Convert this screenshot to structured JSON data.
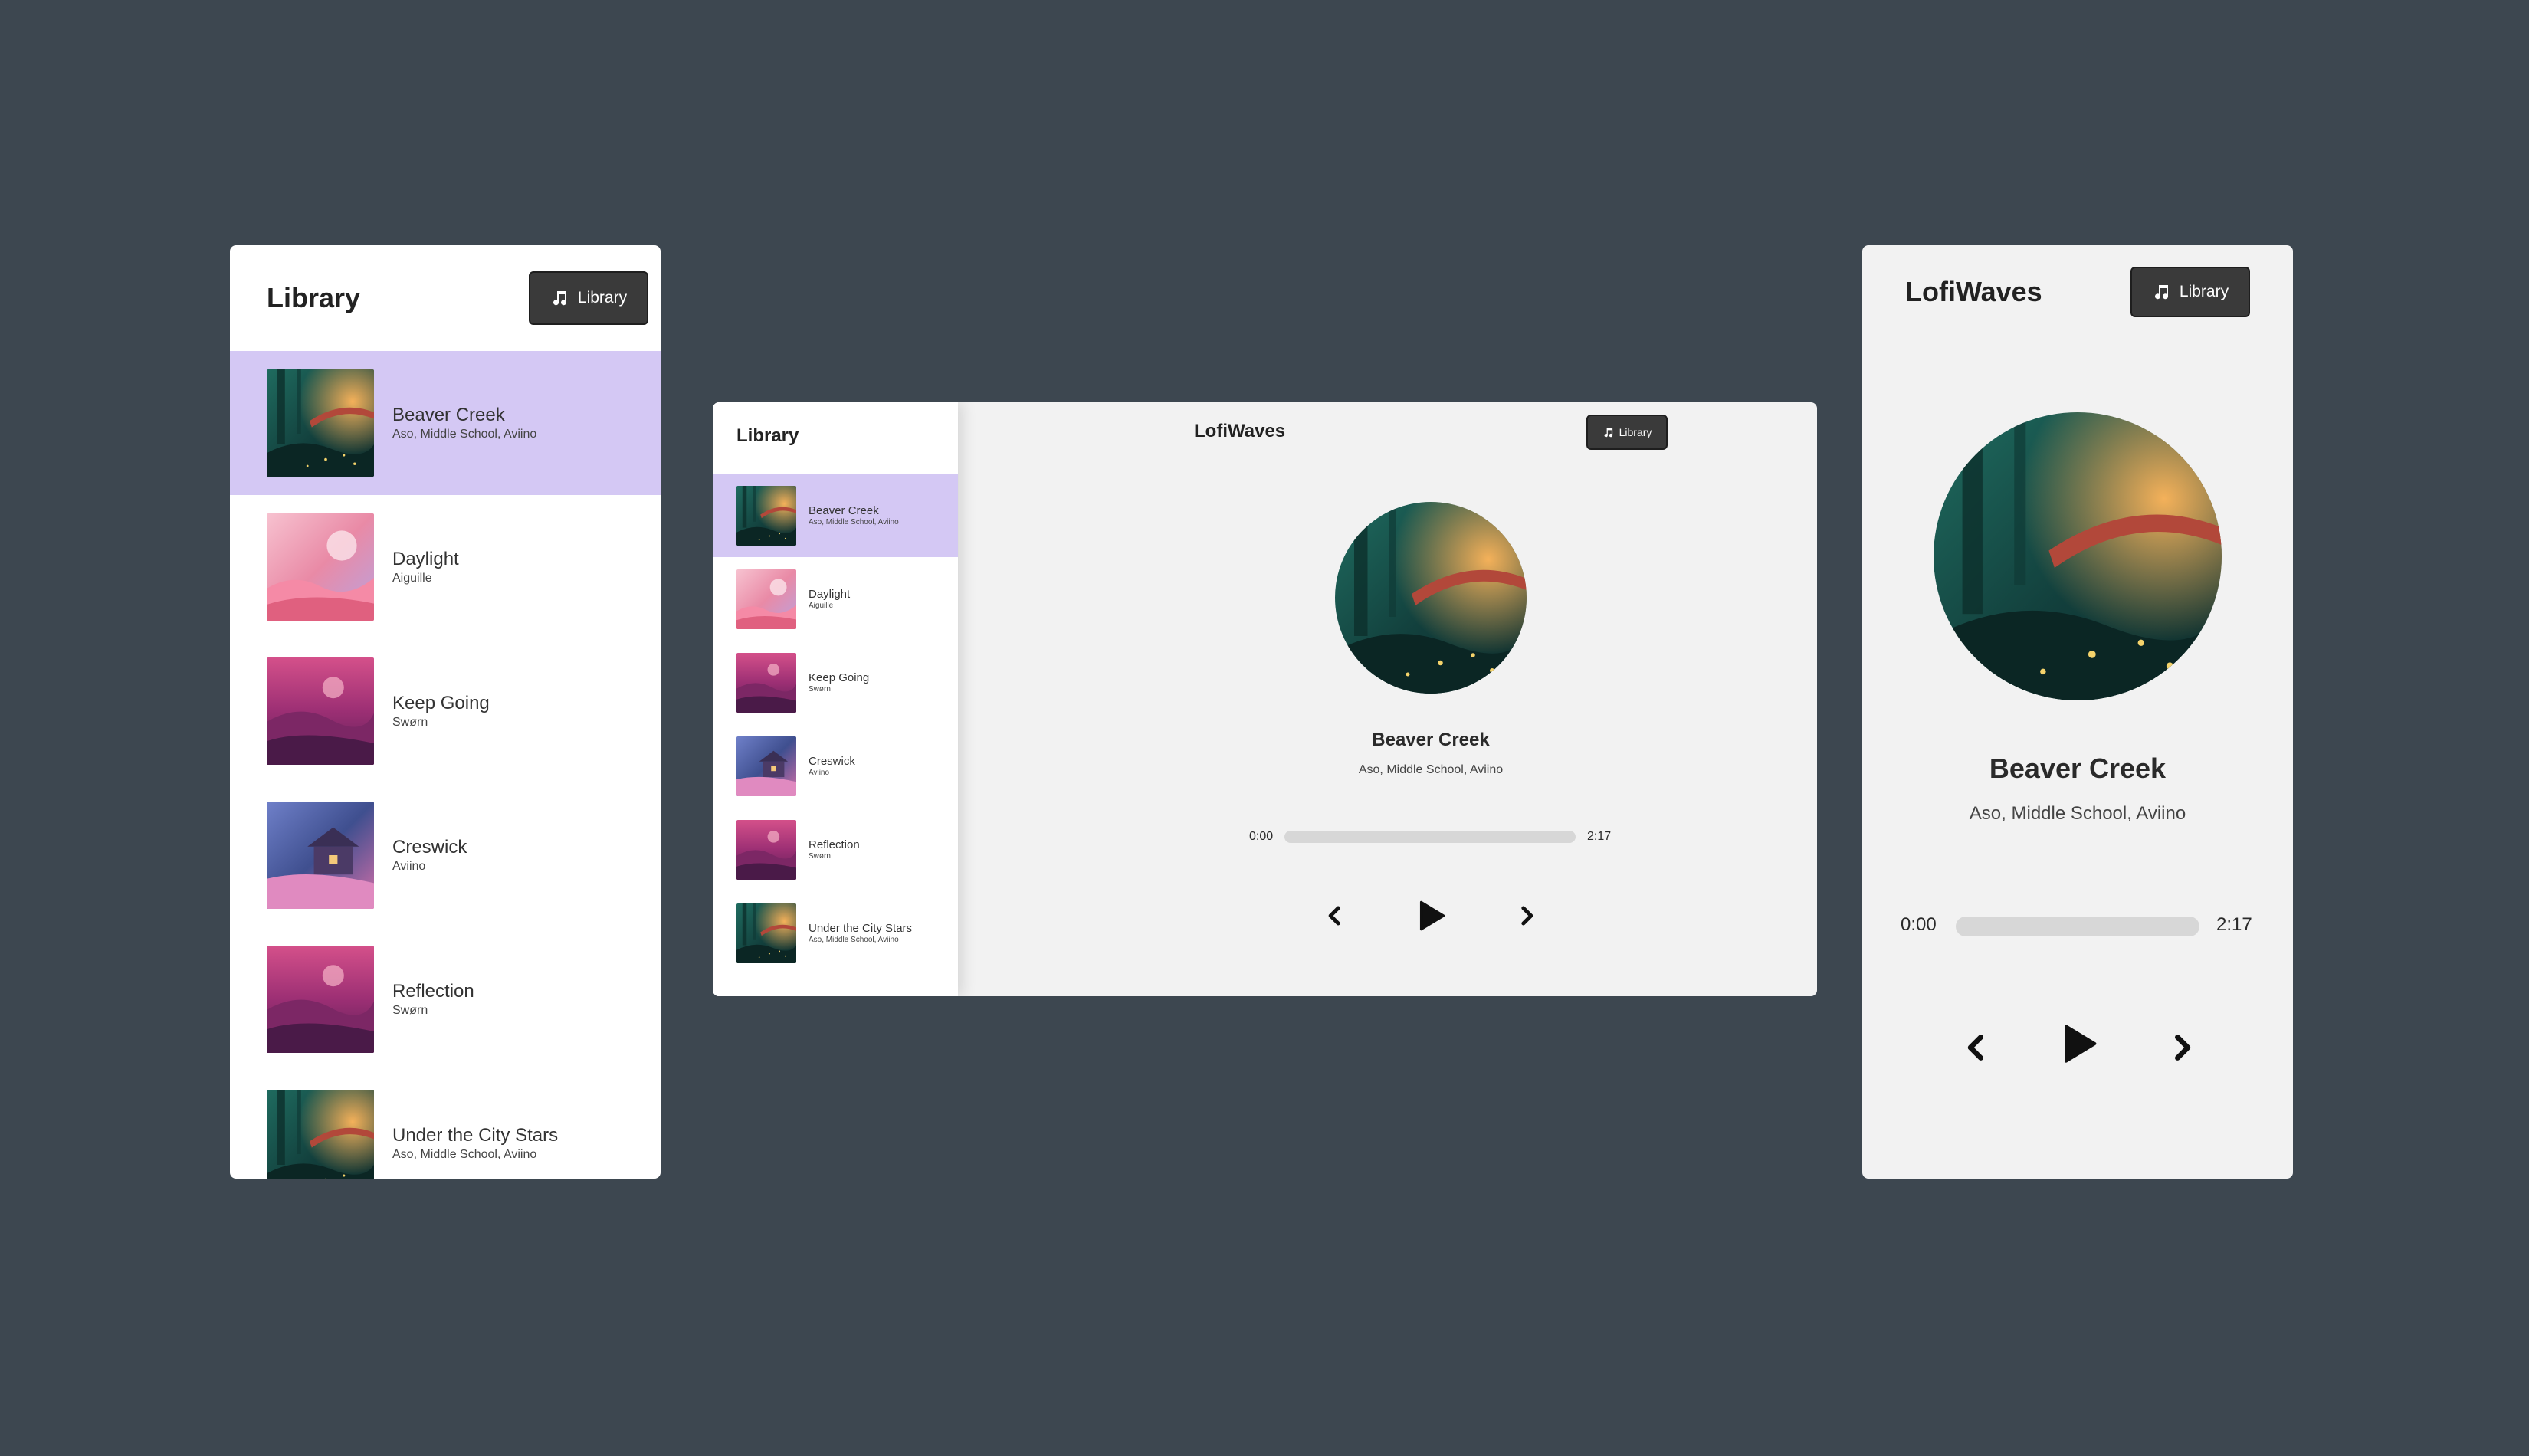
{
  "library": {
    "title": "Library",
    "button_label": "Library",
    "button_icon": "music-note-icon",
    "songs": [
      {
        "title": "Beaver Creek",
        "artist": "Aso, Middle School, Aviino",
        "active": true,
        "art": "forest"
      },
      {
        "title": "Daylight",
        "artist": "Aiguille",
        "active": false,
        "art": "pink-sky"
      },
      {
        "title": "Keep Going",
        "artist": "Swørn",
        "active": false,
        "art": "magenta-hills"
      },
      {
        "title": "Creswick",
        "artist": "Aviino",
        "active": false,
        "art": "blue-cabin"
      },
      {
        "title": "Reflection",
        "artist": "Swørn",
        "active": false,
        "art": "magenta-hills"
      },
      {
        "title": "Under the City Stars",
        "artist": "Aso, Middle School, Aviino",
        "active": false,
        "art": "forest"
      }
    ]
  },
  "player": {
    "brand": "LofiWaves",
    "button_label": "Library",
    "now_playing": {
      "title": "Beaver Creek",
      "artist": "Aso, Middle School, Aviino"
    },
    "current_time": "0:00",
    "duration": "2:17",
    "progress": 0,
    "icons": {
      "prev": "chevron-left-icon",
      "play": "play-icon",
      "next": "chevron-right-icon"
    }
  },
  "colors": {
    "background": "#3d4750",
    "active_row": "#d4c8f4",
    "button": "#3a3a3a",
    "panel_light": "#f2f2f2"
  }
}
